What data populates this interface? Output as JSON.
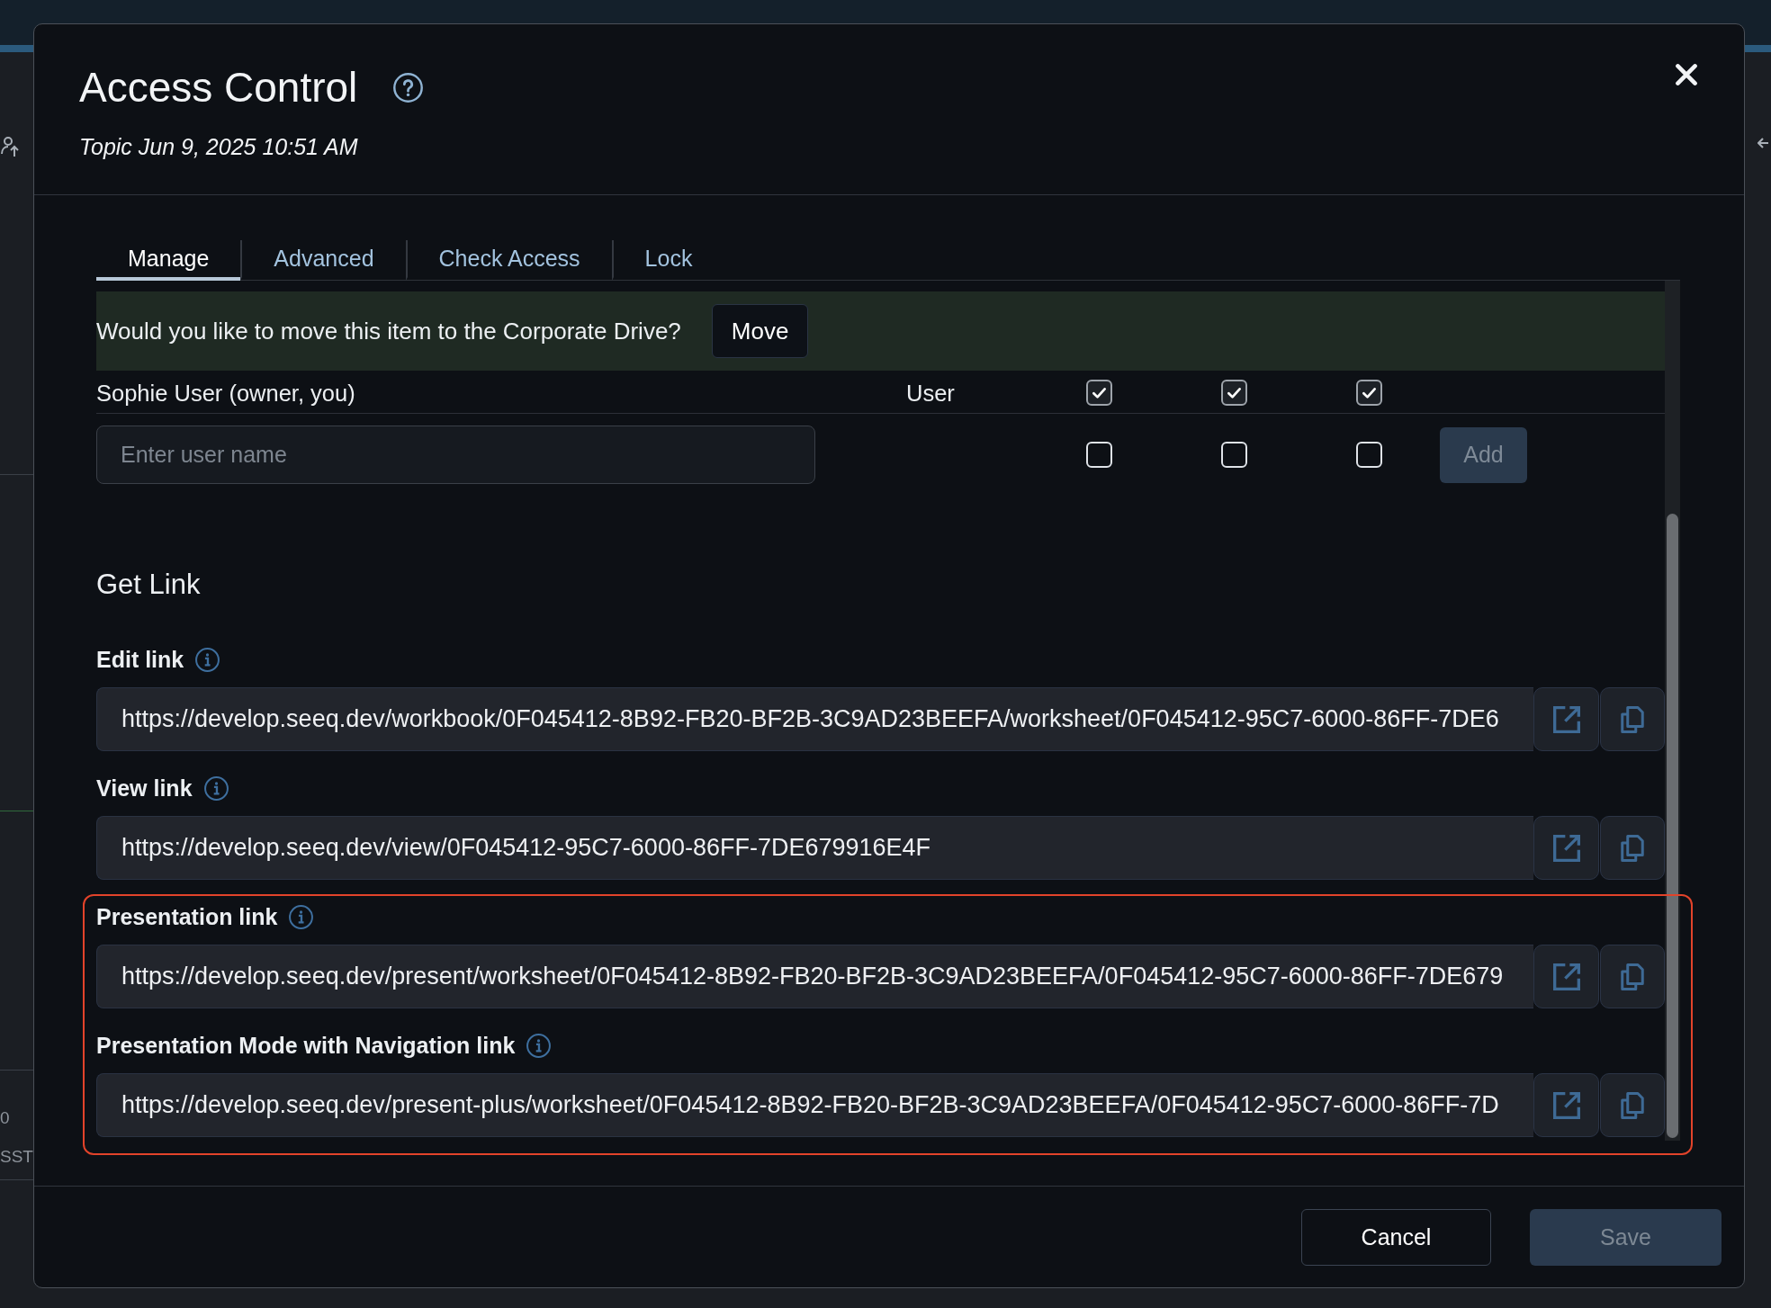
{
  "background_page": {
    "left_panel": {
      "texts": [
        "0",
        "SST"
      ]
    }
  },
  "dialog": {
    "title": "Access Control",
    "subtitle": "Topic Jun 9, 2025 10:51 AM",
    "tabs": [
      {
        "label": "Manage",
        "selected": true
      },
      {
        "label": "Advanced",
        "selected": false
      },
      {
        "label": "Check Access",
        "selected": false
      },
      {
        "label": "Lock",
        "selected": false
      }
    ],
    "move_prompt": {
      "message": "Would you like to move this item to the Corporate Drive?",
      "button": "Move"
    },
    "access_list": {
      "rows": [
        {
          "name": "Sophie User (owner, you)",
          "type": "User",
          "permissions": [
            {
              "checked": true
            },
            {
              "checked": true
            },
            {
              "checked": true
            }
          ]
        }
      ],
      "new_entry": {
        "placeholder": "Enter user name",
        "permissions": [
          {
            "checked": false
          },
          {
            "checked": false
          },
          {
            "checked": false
          }
        ],
        "button": {
          "label": "Add",
          "disabled": true
        }
      }
    },
    "get_link": {
      "heading": "Get Link",
      "links": [
        {
          "label": "Edit link",
          "url": "https://develop.seeq.dev/workbook/0F045412-8B92-FB20-BF2B-3C9AD23BEEFA/worksheet/0F045412-95C7-6000-86FF-7DE6",
          "highlighted": false
        },
        {
          "label": "View link",
          "url": "https://develop.seeq.dev/view/0F045412-95C7-6000-86FF-7DE679916E4F",
          "highlighted": false
        },
        {
          "label": "Presentation link",
          "url": "https://develop.seeq.dev/present/worksheet/0F045412-8B92-FB20-BF2B-3C9AD23BEEFA/0F045412-95C7-6000-86FF-7DE679",
          "highlighted": true
        },
        {
          "label": "Presentation Mode with Navigation link",
          "url": "https://develop.seeq.dev/present-plus/worksheet/0F045412-8B92-FB20-BF2B-3C9AD23BEEFA/0F045412-95C7-6000-86FF-7D",
          "highlighted": true
        }
      ]
    },
    "footer": {
      "buttons": [
        {
          "kind": "secondary",
          "label": "Cancel",
          "disabled": false
        },
        {
          "kind": "primary",
          "label": "Save",
          "disabled": true
        }
      ]
    }
  }
}
